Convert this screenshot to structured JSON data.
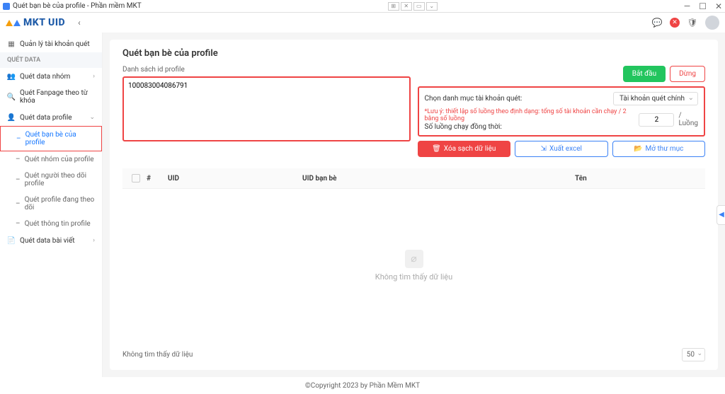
{
  "window": {
    "title": "Quét bạn bè của profile - Phần mềm MKT"
  },
  "brand": {
    "text": "MKT UID"
  },
  "topbar": {
    "messageIcon": "message-icon",
    "closeIcon": "✕",
    "avatar": "avatar"
  },
  "sidebar": {
    "manageAccounts": "Quản lý tài khoản quét",
    "sectionHeader": "QUÉT DATA",
    "quetDataNhom": "Quét data nhóm",
    "quetFanpage": "Quét Fanpage theo từ khóa",
    "quetDataProfile": "Quét data profile",
    "subs": {
      "banBe": "Quét bạn bè của profile",
      "nhom": "Quét nhóm của profile",
      "nguoiTheoDoi": "Quét người theo dõi profile",
      "dangTheoDoi": "Quét profile đang theo dõi",
      "thongTin": "Quét thông tin profile"
    },
    "quetBaiViet": "Quét data bài viết"
  },
  "page": {
    "title": "Quét bạn bè của profile",
    "listLabel": "Danh sách id profile",
    "idValue": "100083004086791",
    "btnStart": "Bắt đầu",
    "btnStop": "Dừng",
    "selectAccountLabel": "Chọn danh mục tài khoản quét:",
    "selectAccountValue": "Tài khoản quét chính",
    "warning": "*Lưu ý: thiết lập số luồng theo định dạng: tổng số tài khoản cần chạy / 2 bằng số luồng",
    "threadsLabel": "Số luồng chạy đồng thời:",
    "threadsValue": "2",
    "threadsSuffix": "/ Luồng",
    "btnClear": "Xóa sạch dữ liệu",
    "btnExport": "Xuất excel",
    "btnOpenFolder": "Mở thư mục",
    "table": {
      "seq": "#",
      "uid": "UID",
      "uidFriend": "UID bạn bè",
      "name": "Tên"
    },
    "emptyText": "Không tìm thấy dữ liệu",
    "footerNoData": "Không tìm thấy dữ liệu",
    "pageSize": "50"
  },
  "footer": {
    "copyright": "©Copyright 2023 by Phần Mềm MKT"
  }
}
